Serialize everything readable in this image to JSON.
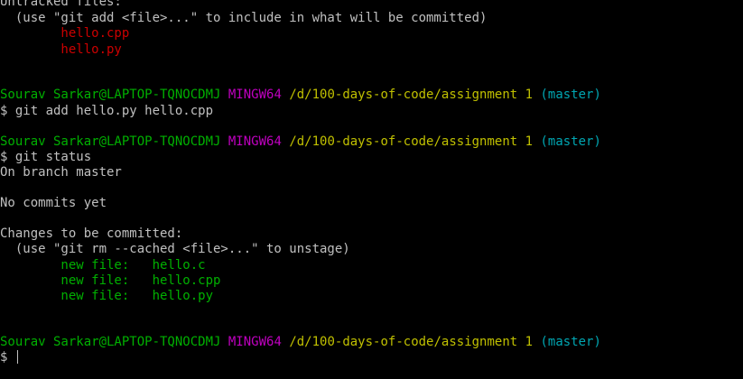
{
  "colors": {
    "background": "#000000",
    "default_text": "#c0c0c0",
    "untracked_red": "#cc0000",
    "user_green": "#00b000",
    "msystem_magenta": "#c000c0",
    "path_yellow": "#c0c000",
    "branch_cyan": "#00a6b2"
  },
  "untracked": {
    "heading": "Untracked files:",
    "hint": "  (use \"git add <file>...\" to include in what will be committed)",
    "files": [
      "        hello.cpp",
      "        hello.py"
    ]
  },
  "prompts": [
    {
      "user_host": "Sourav Sarkar@LAPTOP-TQNOCDMJ",
      "msystem": "MINGW64",
      "path": "/d/100-days-of-code/assignment 1",
      "branch": "(master)",
      "command": "$ git add hello.py hello.cpp"
    },
    {
      "user_host": "Sourav Sarkar@LAPTOP-TQNOCDMJ",
      "msystem": "MINGW64",
      "path": "/d/100-days-of-code/assignment 1",
      "branch": "(master)",
      "command": "$ git status"
    },
    {
      "user_host": "Sourav Sarkar@LAPTOP-TQNOCDMJ",
      "msystem": "MINGW64",
      "path": "/d/100-days-of-code/assignment 1",
      "branch": "(master)",
      "command": "$ "
    }
  ],
  "status_output": {
    "branch_line": "On branch master",
    "commits_line": "No commits yet",
    "staged_heading": "Changes to be committed:",
    "staged_hint": "  (use \"git rm --cached <file>...\" to unstage)",
    "staged_files": [
      "        new file:   hello.c",
      "        new file:   hello.cpp",
      "        new file:   hello.py"
    ]
  }
}
